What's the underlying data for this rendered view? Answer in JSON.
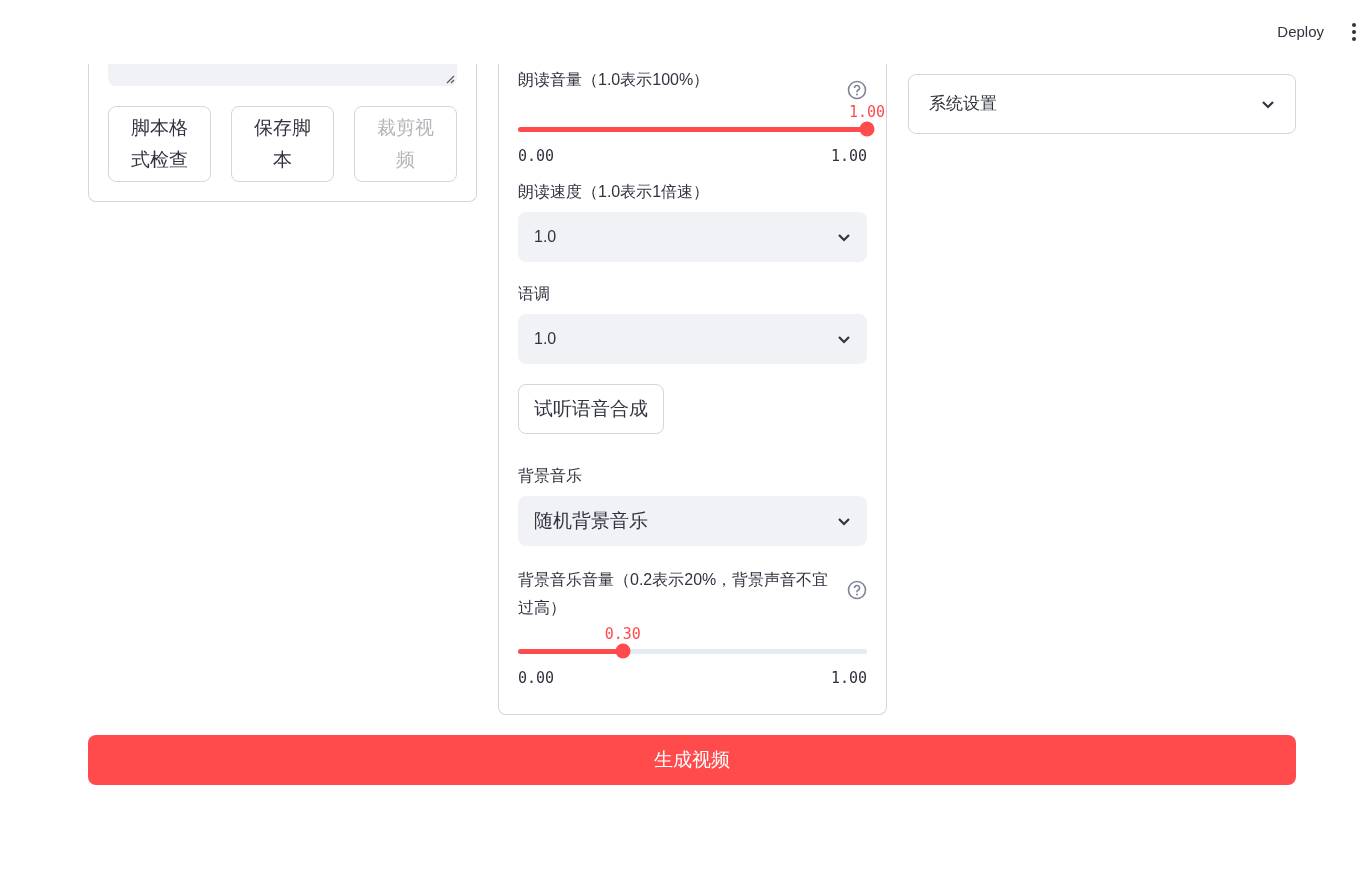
{
  "header": {
    "deploy": "Deploy"
  },
  "left_panel": {
    "buttons": [
      {
        "label": "脚本格式检查",
        "disabled": false
      },
      {
        "label": "保存脚本",
        "disabled": false
      },
      {
        "label": "裁剪视频",
        "disabled": true
      }
    ]
  },
  "middle_panel": {
    "items": [
      {
        "kind": "slider",
        "label": "朗读音量（1.0表示100%）",
        "help": true,
        "value": "1.00",
        "level": 1,
        "min": "0.00",
        "max": "1.00"
      },
      {
        "kind": "select",
        "label": "朗读速度（1.0表示1倍速）",
        "value": "1.0",
        "large": false
      },
      {
        "kind": "select",
        "label": "语调",
        "value": "1.0",
        "large": false
      },
      {
        "kind": "button",
        "label": "试听语音合成"
      },
      {
        "kind": "select",
        "label": "背景音乐",
        "value": "随机背景音乐",
        "large": true
      },
      {
        "kind": "slider",
        "label": "背景音乐音量（0.2表示20%，背景声音不宜过高）",
        "help": true,
        "value": "0.30",
        "level": 0.3,
        "min": "0.00",
        "max": "1.00"
      }
    ]
  },
  "right_panel": {
    "expander": {
      "label": "系统设置",
      "expanded": false
    }
  },
  "generate_button": {
    "label": "生成视频"
  }
}
